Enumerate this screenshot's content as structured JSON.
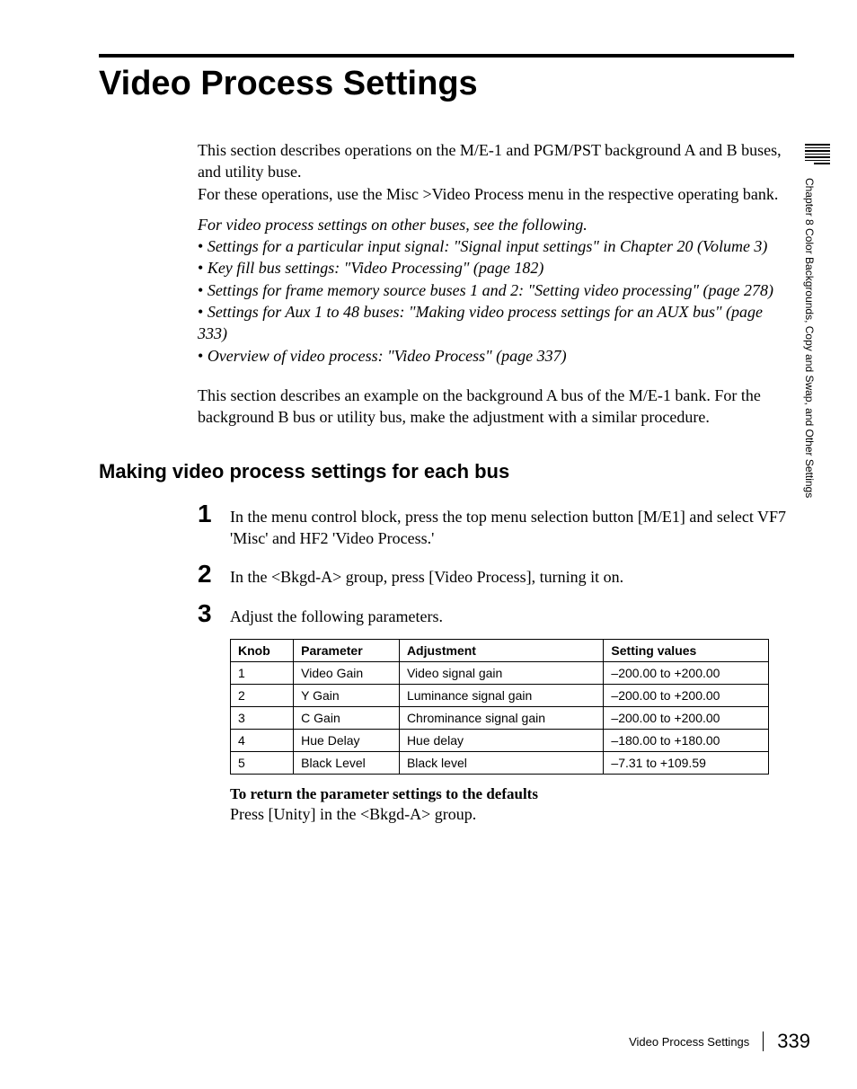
{
  "title": "Video Process Settings",
  "intro": {
    "p1": "This section describes operations on the M/E-1 and PGM/PST background A and B buses, and utility buse.",
    "p2": "For these operations, use the Misc >Video Process menu in the respective operating bank.",
    "ref_intro": "For video process settings on other buses, see the following.",
    "bullets": [
      "Settings for a particular input signal: \"Signal input settings\" in Chapter 20 (Volume 3)",
      "Key fill bus settings: \"Video Processing\" (page 182)",
      "Settings for frame memory source buses 1 and 2: \"Setting video processing\" (page 278)",
      "Settings for Aux 1 to 48 buses: \"Making video process settings for an AUX bus\" (page 333)",
      "Overview of video process: \"Video Process\" (page 337)"
    ],
    "p3": "This section describes an example on the background A bus of the M/E-1 bank. For the background B bus or utility bus, make the adjustment with a similar procedure."
  },
  "heading2": "Making video process settings for each bus",
  "steps": [
    {
      "num": "1",
      "text": "In the menu control block, press the top menu selection button [M/E1] and select VF7 'Misc' and HF2 'Video Process.'"
    },
    {
      "num": "2",
      "text": "In the <Bkgd-A> group, press [Video Process], turning it on."
    },
    {
      "num": "3",
      "text": "Adjust the following parameters."
    }
  ],
  "table": {
    "headers": [
      "Knob",
      "Parameter",
      "Adjustment",
      "Setting values"
    ],
    "rows": [
      [
        "1",
        "Video Gain",
        "Video signal gain",
        "–200.00 to +200.00"
      ],
      [
        "2",
        "Y Gain",
        "Luminance signal gain",
        "–200.00 to +200.00"
      ],
      [
        "3",
        "C Gain",
        "Chrominance signal gain",
        "–200.00 to +200.00"
      ],
      [
        "4",
        "Hue Delay",
        "Hue delay",
        "–180.00 to +180.00"
      ],
      [
        "5",
        "Black Level",
        "Black level",
        "–7.31 to +109.59"
      ]
    ]
  },
  "sub_bold": "To return the parameter settings to the defaults",
  "sub_text": "Press [Unity] in the <Bkgd-A> group.",
  "side_label": "Chapter 8   Color Backgrounds, Copy and Swap, and Other Settings",
  "footer": {
    "title": "Video Process Settings",
    "page": "339"
  }
}
